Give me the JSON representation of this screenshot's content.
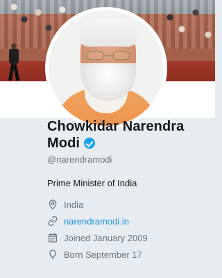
{
  "profile": {
    "name_line1": "Chowkidar Narendra",
    "name_line2": "Modi",
    "handle": "@narendramodi",
    "bio": "Prime Minister of India",
    "details": {
      "location": "India",
      "website": "narendramodi.in",
      "joined": "Joined January 2009",
      "born": "Born September 17"
    }
  },
  "icons": {
    "verified": "verified-badge-icon",
    "location": "location-pin-icon",
    "website": "link-icon",
    "joined": "calendar-icon",
    "born": "balloon-icon"
  },
  "colors": {
    "page_bg": "#e6ecf0",
    "text_primary": "#14171a",
    "text_secondary": "#657786",
    "link": "#1b95e0",
    "verified": "#1da1f2"
  }
}
